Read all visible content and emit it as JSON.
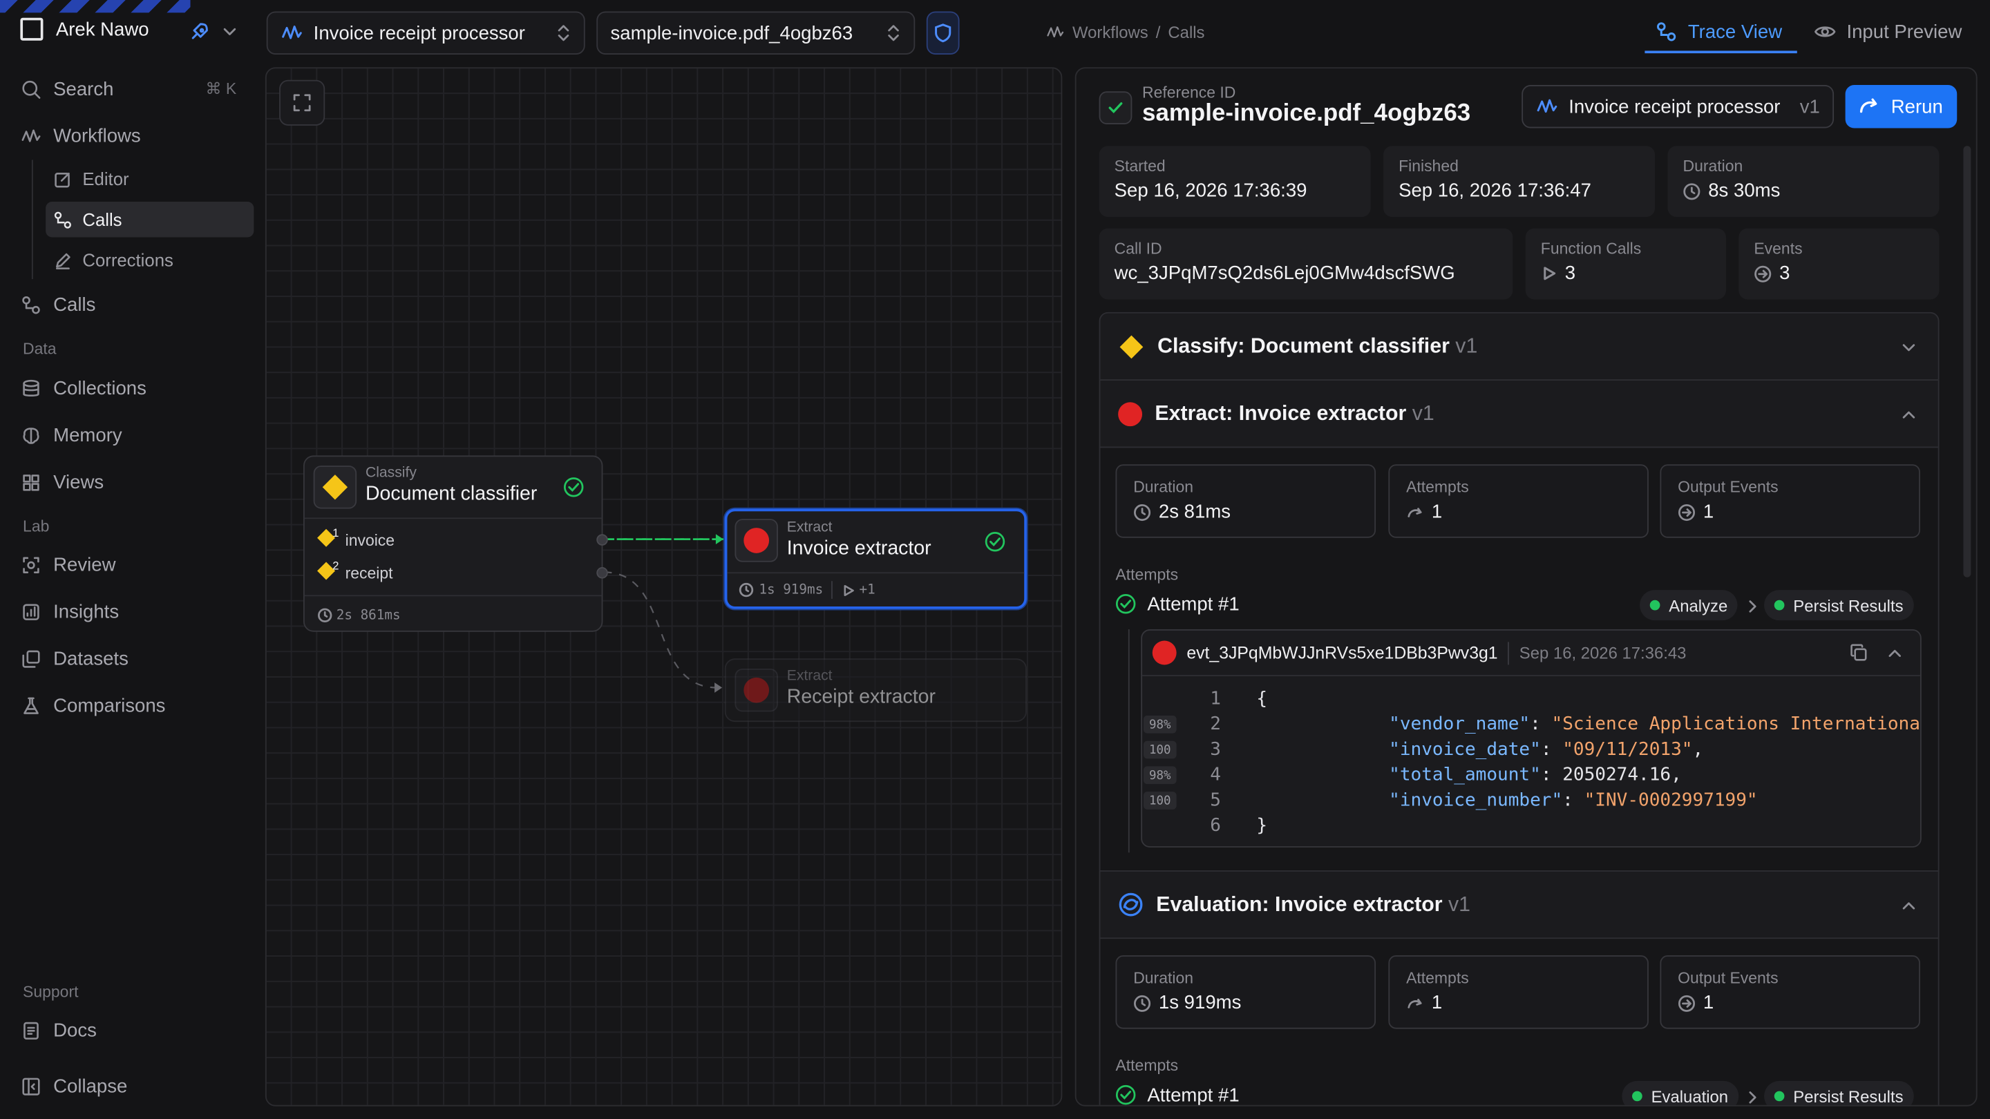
{
  "sidebar": {
    "workspace": "Arek Nawo",
    "search": {
      "label": "Search",
      "shortcut": "⌘ K"
    },
    "workflows": "Workflows",
    "workflow_sub": [
      "Editor",
      "Calls",
      "Corrections"
    ],
    "calls": "Calls",
    "data_section": "Data",
    "data_items": [
      "Collections",
      "Memory",
      "Views"
    ],
    "lab_section": "Lab",
    "lab_items": [
      "Review",
      "Insights",
      "Datasets",
      "Comparisons"
    ],
    "support_section": "Support",
    "docs": "Docs",
    "collapse": "Collapse"
  },
  "topbar": {
    "workflow_select": "Invoice receipt processor",
    "file_select": "sample-invoice.pdf_4ogbz63",
    "breadcrumb": [
      "Workflows",
      "Calls"
    ],
    "breadcrumb_sep": "/",
    "tabs": [
      "Trace View",
      "Input Preview"
    ]
  },
  "graph": {
    "classify_node": {
      "kind": "Classify",
      "title": "Document classifier",
      "ports": [
        "invoice",
        "receipt"
      ],
      "port_nums": [
        "1",
        "2"
      ],
      "duration": "2s 861ms"
    },
    "extract_node": {
      "kind": "Extract",
      "title": "Invoice extractor",
      "duration": "1s 919ms",
      "extra": "+1"
    },
    "receipt_node": {
      "kind": "Extract",
      "title": "Receipt extractor"
    }
  },
  "panel": {
    "ref_label": "Reference ID",
    "ref_value": "sample-invoice.pdf_4ogbz63",
    "workflow_btn": "Invoice receipt processor",
    "workflow_ver": "v1",
    "rerun": "Rerun",
    "started": {
      "label": "Started",
      "value": "Sep 16, 2026 17:36:39"
    },
    "finished": {
      "label": "Finished",
      "value": "Sep 16, 2026 17:36:47"
    },
    "duration": {
      "label": "Duration",
      "value": "8s 30ms"
    },
    "call_id": {
      "label": "Call ID",
      "value": "wc_3JPqM7sQ2ds6Lej0GMw4dscfSWG"
    },
    "function_calls": {
      "label": "Function Calls",
      "value": "3"
    },
    "events": {
      "label": "Events",
      "value": "3"
    },
    "classify_section": {
      "title": "Classify: Document classifier",
      "ver": "v1"
    },
    "extract_section": {
      "title": "Extract: Invoice extractor",
      "ver": "v1",
      "duration": {
        "label": "Duration",
        "value": "2s 81ms"
      },
      "attempts": {
        "label": "Attempts",
        "value": "1"
      },
      "output_events": {
        "label": "Output Events",
        "value": "1"
      },
      "attempts_label": "Attempts",
      "attempt": "Attempt #1",
      "pills": [
        "Analyze",
        "Persist Results"
      ],
      "event": {
        "id": "evt_3JPqMbWJJnRVs5xe1DBb3Pwv3g1",
        "time": "Sep 16, 2026 17:36:43",
        "lines": [
          {
            "n": "1",
            "conf": "",
            "text": "{"
          },
          {
            "n": "2",
            "conf": "98%",
            "key": "\"vendor_name\"",
            "val": "\"Science Applications International Corp.\"",
            "end": ","
          },
          {
            "n": "3",
            "conf": "100",
            "key": "\"invoice_date\"",
            "val": "\"09/11/2013\"",
            "end": ","
          },
          {
            "n": "4",
            "conf": "98%",
            "key": "\"total_amount\"",
            "num": "2050274.16",
            "end": ","
          },
          {
            "n": "5",
            "conf": "100",
            "key": "\"invoice_number\"",
            "val": "\"INV-0002997199\"",
            "end": ""
          },
          {
            "n": "6",
            "conf": "",
            "text": "}"
          }
        ]
      }
    },
    "evaluation_section": {
      "title": "Evaluation: Invoice extractor",
      "ver": "v1",
      "duration": {
        "label": "Duration",
        "value": "1s 919ms"
      },
      "attempts": {
        "label": "Attempts",
        "value": "1"
      },
      "output_events": {
        "label": "Output Events",
        "value": "1"
      },
      "attempts_label": "Attempts",
      "attempt": "Attempt #1",
      "pills": [
        "Evaluation",
        "Persist Results"
      ]
    }
  },
  "colors": {
    "accent": "#3b82f6",
    "success": "#22c55e",
    "warning": "#f5c518",
    "error": "#e02424"
  }
}
